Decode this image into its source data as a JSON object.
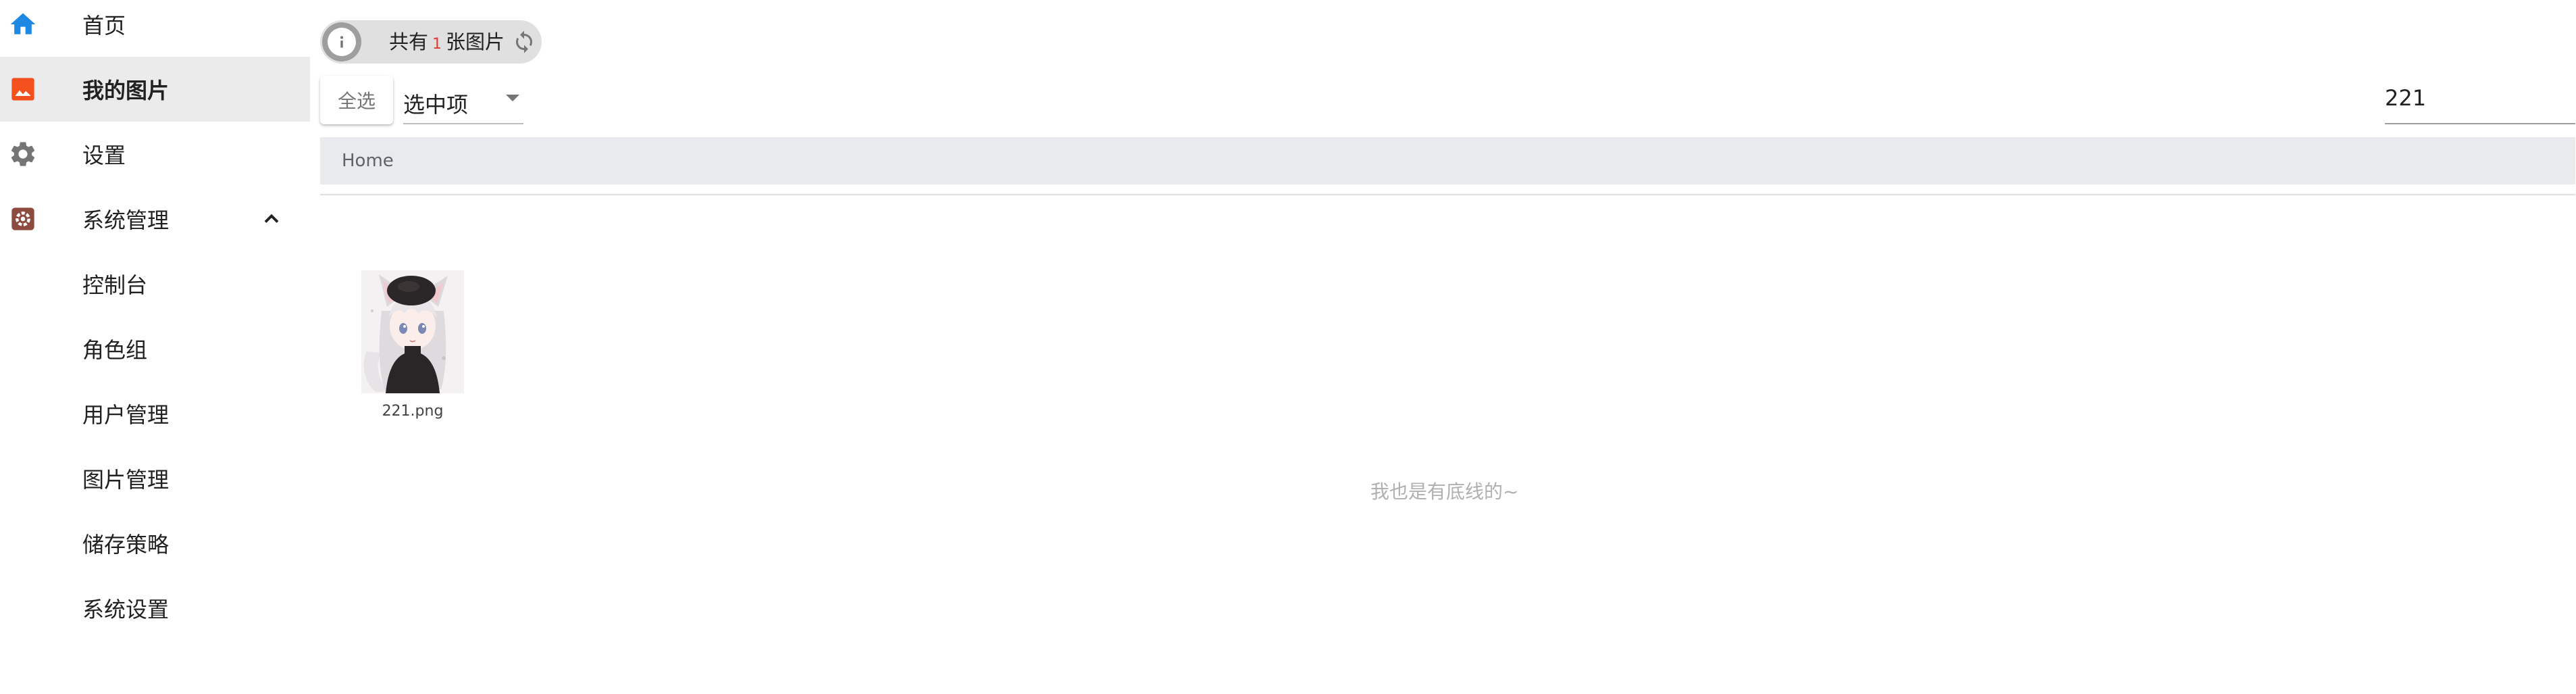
{
  "sidebar": {
    "items": [
      {
        "label": "首页",
        "icon": "home-icon"
      },
      {
        "label": "我的图片",
        "icon": "image-icon",
        "active": true
      },
      {
        "label": "设置",
        "icon": "gear-icon"
      },
      {
        "label": "系统管理",
        "icon": "admin-settings-icon",
        "expanded": true
      },
      {
        "label": "控制台"
      },
      {
        "label": "角色组"
      },
      {
        "label": "用户管理"
      },
      {
        "label": "图片管理"
      },
      {
        "label": "储存策略"
      },
      {
        "label": "系统设置"
      }
    ]
  },
  "toolbar": {
    "count_prefix": "共有",
    "count_value": "1",
    "count_suffix": "张图片",
    "select_all_label": "全选",
    "selected_dropdown_value": "选中项",
    "search_value": "221"
  },
  "breadcrumb": {
    "items": [
      "Home"
    ]
  },
  "gallery": {
    "images": [
      {
        "file_name": "221.png"
      }
    ]
  },
  "footer_note": "我也是有底线的~",
  "colors": {
    "accent_blue": "#1e88e5",
    "accent_orange": "#f4511e",
    "gear_gray": "#757575",
    "admin_brown": "#8d4a3f",
    "count_red": "#e53935"
  }
}
